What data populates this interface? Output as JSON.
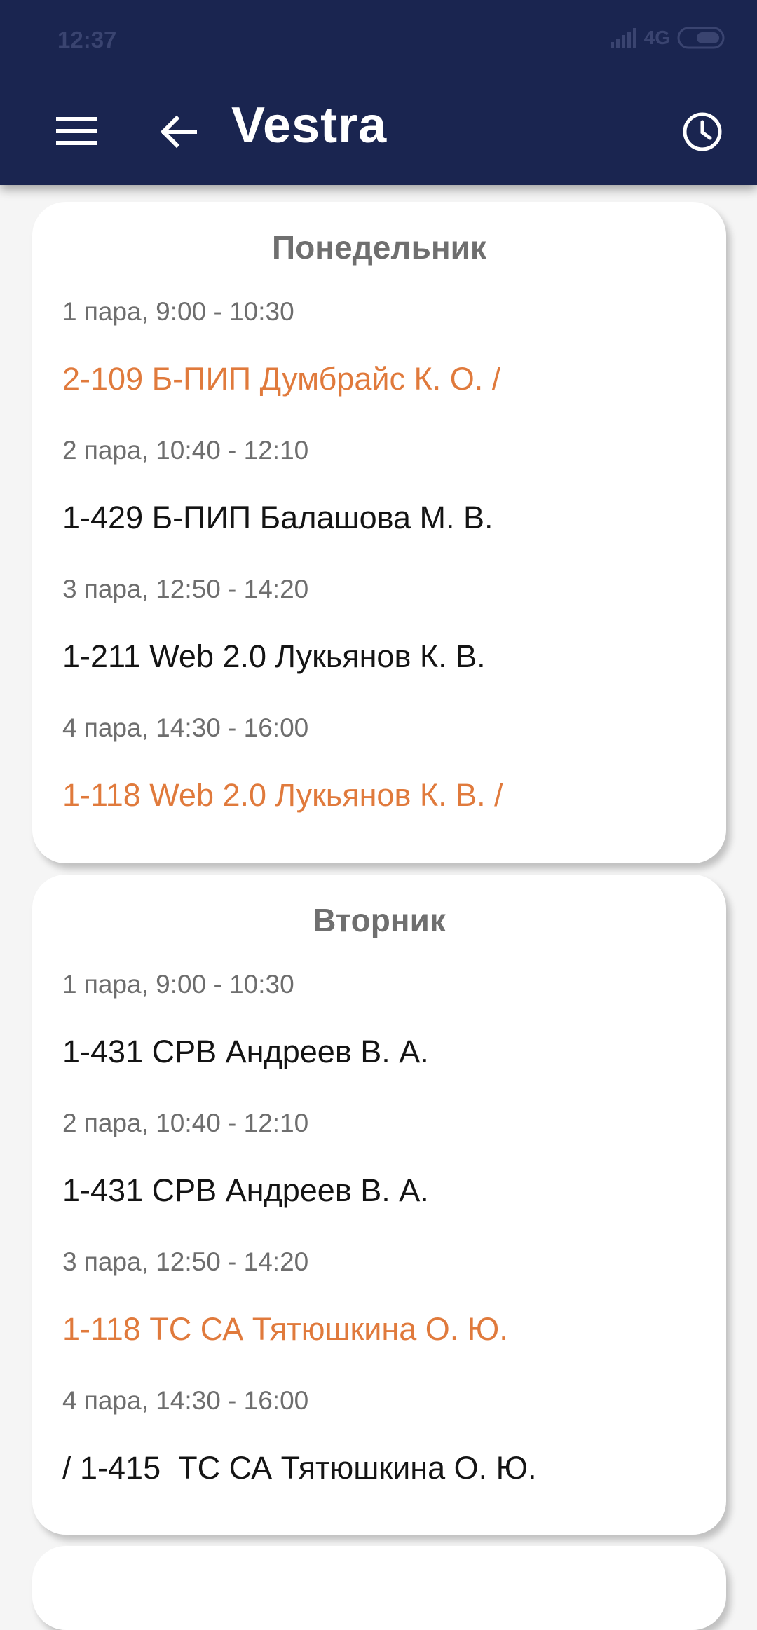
{
  "status_bar": {
    "time": "12:37",
    "network": "4G"
  },
  "app_bar": {
    "title": "Vestra"
  },
  "colors": {
    "app_bar": "#1a2550",
    "highlight": "#e07a3c"
  },
  "days": [
    {
      "name": "Понедельник",
      "slots": [
        {
          "time": "1 пара, 9:00 - 10:30",
          "lesson": "2-109 Б-ПИП Думбрайс К. О. /",
          "highlight": true
        },
        {
          "time": "2 пара, 10:40 - 12:10",
          "lesson": "1-429 Б-ПИП Балашова М. В.",
          "highlight": false
        },
        {
          "time": "3 пара, 12:50 - 14:20",
          "lesson": "1-211 Web 2.0 Лукьянов К. В.",
          "highlight": false
        },
        {
          "time": "4 пара, 14:30 - 16:00",
          "lesson": "1-118 Web 2.0 Лукьянов К. В. /",
          "highlight": true
        }
      ]
    },
    {
      "name": "Вторник",
      "slots": [
        {
          "time": "1 пара, 9:00 - 10:30",
          "lesson": "1-431 СРВ Андреев В. А.",
          "highlight": false
        },
        {
          "time": "2 пара, 10:40 - 12:10",
          "lesson": "1-431 СРВ Андреев В. А.",
          "highlight": false
        },
        {
          "time": "3 пара, 12:50 - 14:20",
          "lesson": "1-118 ТС СА Тятюшкина О. Ю.",
          "highlight": true
        },
        {
          "time": "4 пара, 14:30 - 16:00",
          "lesson": "/ 1-415  ТС СА Тятюшкина О. Ю.",
          "highlight": false
        }
      ]
    }
  ]
}
